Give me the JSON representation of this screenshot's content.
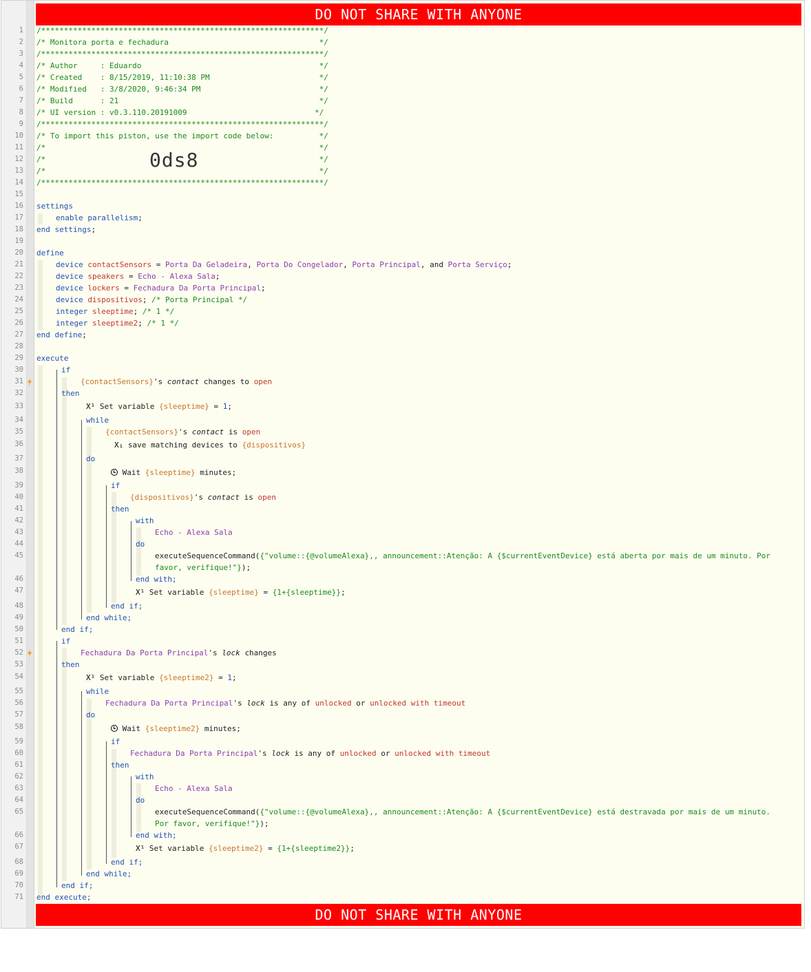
{
  "banner": {
    "text": "DO NOT SHARE WITH ANYONE"
  },
  "header": {
    "star_line": "/**************************************************************/",
    "title_line": "/* Monitora porta e fechadura                                 */",
    "author_line": "/* Author     : Eduardo                                       */",
    "created_line": "/* Created    : 8/15/2019, 11:10:38 PM                        */",
    "modified_line": "/* Modified   : 3/8/2020, 9:46:34 PM                          */",
    "build_line": "/* Build      : 21                                            */",
    "ui_line": "/* UI version : v0.3.110.20191009                            */",
    "import_line": "/* To import this piston, use the import code below:          */",
    "blank_line": "/*                                                            */",
    "import_code": "0ds8"
  },
  "line_numbers": [
    "1",
    "2",
    "3",
    "4",
    "5",
    "6",
    "7",
    "8",
    "9",
    "10",
    "11",
    "12",
    "13",
    "14",
    "15",
    "16",
    "17",
    "18",
    "19",
    "20",
    "21",
    "22",
    "23",
    "24",
    "25",
    "26",
    "27",
    "28",
    "29",
    "30",
    "31",
    "32",
    "33",
    "34",
    "35",
    "36",
    "37",
    "38",
    "39",
    "40",
    "41",
    "42",
    "43",
    "44",
    "45",
    "46",
    "47",
    "48",
    "49",
    "50",
    "51",
    "52",
    "53",
    "54",
    "55",
    "56",
    "57",
    "58",
    "59",
    "60",
    "61",
    "62",
    "63",
    "64",
    "65",
    "66",
    "67",
    "68",
    "69",
    "70",
    "71"
  ],
  "code": {
    "settings": "settings",
    "enable": "enable parallelism",
    "end_settings": "end settings",
    "define": "define",
    "d1_kw": "device",
    "d1_name": "contactSensors",
    "d1_v1": "Porta Da Geladeira",
    "d1_v2": "Porta Do Congelador",
    "d1_v3": "Porta Principal",
    "d1_and": "and",
    "d1_v4": "Porta Serviço",
    "d2_kw": "device",
    "d2_name": "speakers",
    "d2_v1": "Echo - Alexa Sala",
    "d3_kw": "device",
    "d3_name": "lockers",
    "d3_v1": "Fechadura Da Porta Principal",
    "d4_kw": "device",
    "d4_name": "dispositivos",
    "d4_cm": "/* Porta Principal */",
    "d5_kw": "integer",
    "d5_name": "sleeptime",
    "d5_cm": "/* 1 */",
    "d6_kw": "integer",
    "d6_name": "sleeptime2",
    "d6_cm": "/* 1 */",
    "end_define": "end define",
    "execute": "execute",
    "if": "if",
    "then": "then",
    "while": "while",
    "do": "do",
    "with": "with",
    "end_with": "end with",
    "end_if": "end if",
    "end_while": "end while",
    "end_execute": "end execute",
    "cs_expr": "{contactSensors}",
    "contact": "contact",
    "changes_to": "changes to",
    "is": "is",
    "open": "open",
    "set_variable": "Set variable",
    "sleeptime_expr": "{sleeptime}",
    "sleeptime2_expr": "{sleeptime2}",
    "one": "1",
    "save_matching": "save matching devices to",
    "dispositivos_expr": "{dispositivos}",
    "wait": "Wait",
    "minutes": "minutes",
    "echo": "Echo - Alexa Sala",
    "exec_cmd_1a": "executeSequenceCommand(",
    "exec_str_1a": "{\"volume::{@volumeAlexa},, announcement::Atenção: A {$currentEventDevice} está aberta por mais de um minuto. Por",
    "exec_str_1b": "favor, verifique!\"}",
    "exec_str_2a": "{\"volume::{@volumeAlexa},, announcement::Atenção: A {$currentEventDevice} está destravada por mais de um minuto.",
    "exec_str_2b": "Por favor, verifique!\"}",
    "incr_1": "{1+{sleeptime}}",
    "incr_2": "{1+{sleeptime2}}",
    "fechadura": "Fechadura Da Porta Principal",
    "lock": "lock",
    "changes": "changes",
    "is_any_of": "is any of",
    "unlocked": "unlocked",
    "or": "or",
    "unlocked_timeout": "unlocked with timeout"
  },
  "colors": {
    "banner": "#ff0000",
    "comment": "#1b8a1b",
    "keyword": "#2050b8",
    "variable": "#c0392b",
    "device": "#8a3eb0",
    "expression": "#c7762a",
    "trigger_bolt": "#f39c12"
  }
}
